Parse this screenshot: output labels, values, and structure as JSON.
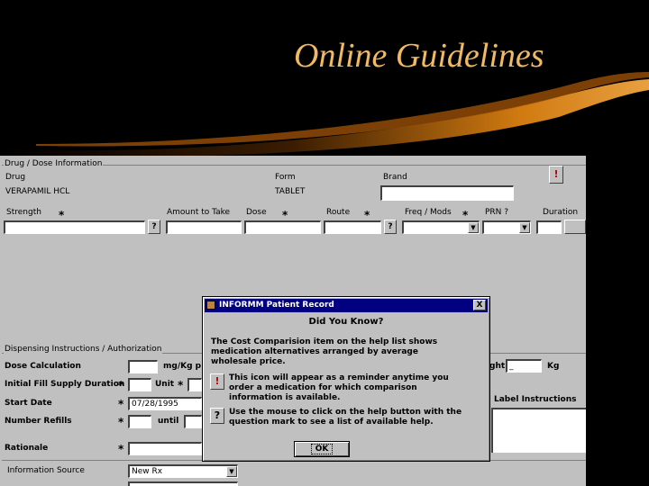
{
  "slide": {
    "title": "Online Guidelines"
  },
  "colors": {
    "title": "#f1b964",
    "swoosh": "#d07a10",
    "form_bg": "#c0c0c0",
    "dialog_title_bar": "#000080"
  },
  "drug_section": {
    "group_label": "Drug / Dose Information",
    "drug_label": "Drug",
    "drug_value": "VERAPAMIL HCL",
    "form_label": "Form",
    "form_value": "TABLET",
    "brand_label": "Brand",
    "brand_value": "",
    "info_icon": "!"
  },
  "dose_row": {
    "strength_label": "Strength",
    "amount_label": "Amount to Take",
    "dose_label": "Dose",
    "route_label": "Route",
    "freq_label": "Freq / Mods",
    "prn_label": "PRN ?",
    "duration_label": "Duration",
    "required_marker": "*"
  },
  "dispensing_section": {
    "group_label": "Dispensing Instructions / Authorization",
    "dose_calc_label": "Dose Calculation",
    "dose_calc_unit": "mg/Kg p",
    "initial_fill_label": "Initial Fill Supply Duration",
    "unit_label": "Unit",
    "start_date_label": "Start Date",
    "start_date_value": "07/28/1995",
    "refills_label": "Number Refills",
    "until_label": "until",
    "rationale_label": "Rationale",
    "weight_label": "ght",
    "weight_value": "_",
    "weight_unit": "Kg",
    "label_instructions": "Label Instructions"
  },
  "info_source": {
    "label": "Information Source",
    "value": "New Rx"
  },
  "dialog": {
    "title": "INFORMM Patient Record",
    "close_label": "X",
    "heading": "Did You Know?",
    "paragraph1": "The Cost Comparision item on the  help list shows medication alternatives arranged by average wholesale price.",
    "icon1": "!",
    "paragraph2": "This icon will appear as a reminder anytime you order a medication for which comparison information is available.",
    "icon2": "?",
    "paragraph3": "Use the mouse to click on the help button with the question mark to see a list of available help.",
    "ok_label": "OK"
  }
}
